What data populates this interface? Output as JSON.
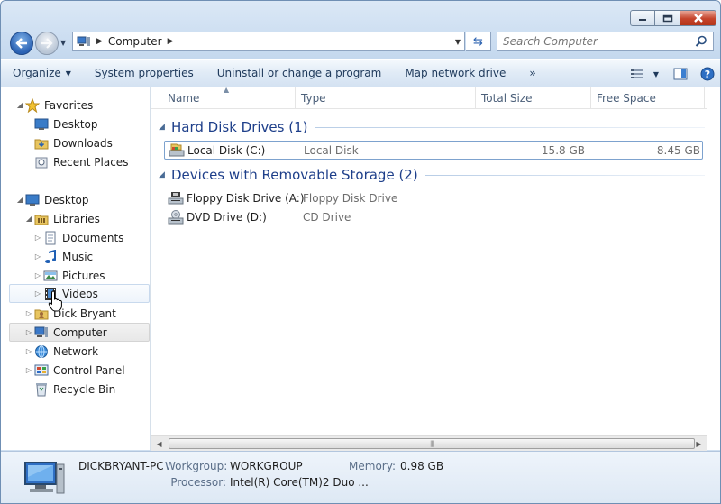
{
  "address": {
    "path": [
      "Computer"
    ]
  },
  "search": {
    "placeholder": "Search Computer"
  },
  "toolbar": {
    "organize": "Organize",
    "system_properties": "System properties",
    "uninstall": "Uninstall or change a program",
    "map_network_drive": "Map network drive",
    "more": "»"
  },
  "nav": {
    "favorites": "Favorites",
    "desktop_fav": "Desktop",
    "downloads": "Downloads",
    "recent_places": "Recent Places",
    "desktop": "Desktop",
    "libraries": "Libraries",
    "documents": "Documents",
    "music": "Music",
    "pictures": "Pictures",
    "videos": "Videos",
    "user": "Dick Bryant",
    "computer": "Computer",
    "network": "Network",
    "control_panel": "Control Panel",
    "recycle_bin": "Recycle Bin"
  },
  "columns": {
    "name": "Name",
    "type": "Type",
    "total_size": "Total Size",
    "free_space": "Free Space"
  },
  "groups": {
    "hard_disks": {
      "title": "Hard Disk Drives (1)",
      "items": [
        {
          "name": "Local Disk (C:)",
          "type": "Local Disk",
          "total": "15.8 GB",
          "free": "8.45 GB"
        }
      ]
    },
    "removable": {
      "title": "Devices with Removable Storage (2)",
      "items": [
        {
          "name": "Floppy Disk Drive (A:)",
          "type": "Floppy Disk Drive"
        },
        {
          "name": "DVD Drive (D:)",
          "type": "CD Drive"
        }
      ]
    }
  },
  "details": {
    "computer_name": "DICKBRYANT-PC",
    "workgroup_label": "Workgroup:",
    "workgroup": "WORKGROUP",
    "memory_label": "Memory:",
    "memory": "0.98 GB",
    "processor_label": "Processor:",
    "processor": "Intel(R) Core(TM)2 Duo ..."
  }
}
